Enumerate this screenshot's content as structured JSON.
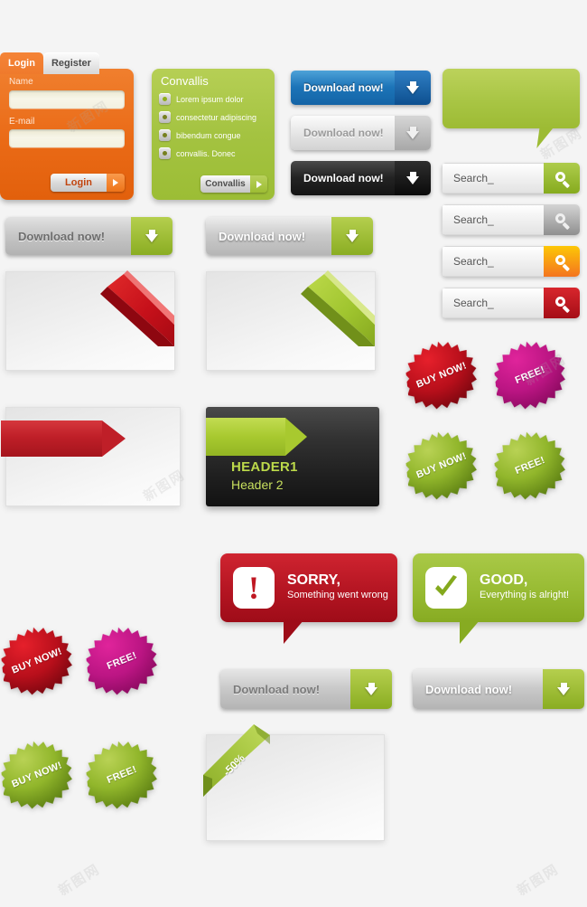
{
  "login_panel": {
    "tabs": [
      {
        "label": "Login",
        "active": true
      },
      {
        "label": "Register",
        "active": false
      }
    ],
    "fields": [
      {
        "label": "Name",
        "value": "",
        "placeholder": ""
      },
      {
        "label": "E-mail",
        "value": "",
        "placeholder": ""
      }
    ],
    "submit_label": "Login"
  },
  "convallis_panel": {
    "title": "Convallis",
    "items": [
      "Lorem  ipsum  dolor",
      "consectetur adipiscing",
      "bibendum  congue",
      "convallis.  Donec"
    ],
    "button_label": "Convallis"
  },
  "download_buttons": {
    "blue": "Download now!",
    "gray_light": "Download now!",
    "black": "Download now!",
    "green_a": "Download now!",
    "green_b": "Download now!",
    "green_c": "Download now!",
    "green_d": "Download now!"
  },
  "search_boxes": [
    {
      "value": "Search_",
      "accent": "#8fb327",
      "accent_name": "green"
    },
    {
      "value": "Search_",
      "accent": "#9f9f9f",
      "accent_name": "gray"
    },
    {
      "value": "Search_",
      "accent": "#f79314",
      "accent_name": "orange"
    },
    {
      "value": "Search_",
      "accent": "#b3121b",
      "accent_name": "red"
    }
  ],
  "header_card": {
    "title": "HEADER1",
    "subtitle": "Header 2",
    "accent": "#bcd94a"
  },
  "badges_right": [
    {
      "label": "BUY NOW!",
      "color": "#c1121f",
      "color_name": "red"
    },
    {
      "label": "FREE!",
      "color": "#bd1a84",
      "color_name": "magenta"
    },
    {
      "label": "BUY NOW!",
      "color": "#7fa520",
      "color_name": "green"
    },
    {
      "label": "FREE!",
      "color": "#7fa520",
      "color_name": "green"
    }
  ],
  "badges_left": [
    {
      "label": "BUY NOW!",
      "color": "#c1121f",
      "color_name": "red"
    },
    {
      "label": "FREE!",
      "color": "#bd1a84",
      "color_name": "magenta"
    },
    {
      "label": "BUY NOW!",
      "color": "#7fa520",
      "color_name": "green"
    },
    {
      "label": "FREE!",
      "color": "#7fa520",
      "color_name": "green"
    }
  ],
  "notifications": [
    {
      "title": "SORRY,",
      "message": "Something went wrong",
      "icon": "exclamation-icon",
      "color": "#b41522"
    },
    {
      "title": "GOOD,",
      "message": "Everything is alright!",
      "icon": "check-icon",
      "color": "#98bb33"
    }
  ],
  "discount_card": {
    "ribbon_label": "-50%",
    "ribbon_color": "#a5c53f"
  },
  "ribbon_cards": [
    {
      "corner_color": "#cf1f28",
      "corner_name": "red-corner-ribbon"
    },
    {
      "corner_color": "#a5c53f",
      "corner_name": "green-corner-ribbon"
    }
  ],
  "tag_cards": [
    {
      "tag_color": "#c3282f",
      "tag_name": "red-arrow-tag"
    }
  ],
  "speech_bubble": {
    "color": "#a8c544"
  },
  "watermarks": [
    "新图网",
    "新图网",
    "新图网",
    "新图网",
    "新图网",
    "新图网"
  ]
}
